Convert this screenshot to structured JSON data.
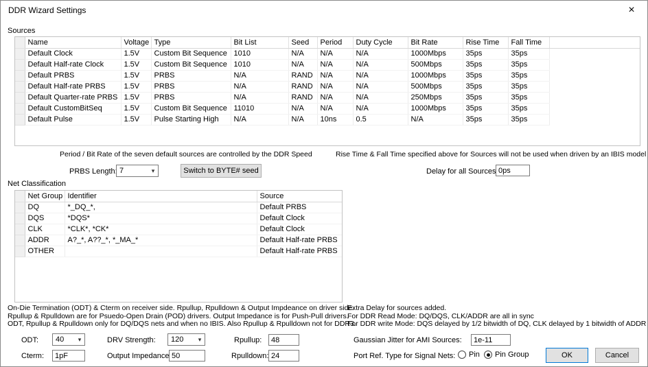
{
  "window": {
    "title": "DDR Wizard Settings",
    "close_glyph": "×"
  },
  "sources": {
    "section_label": "Sources",
    "table": {
      "columns": [
        "Name",
        "Voltage",
        "Type",
        "Bit List",
        "Seed",
        "Period",
        "Duty Cycle",
        "Bit Rate",
        "Rise Time",
        "Fall Time"
      ],
      "rows": [
        [
          "Default Clock",
          "1.5V",
          "Custom Bit Sequence",
          "1010",
          "N/A",
          "N/A",
          "N/A",
          "1000Mbps",
          "35ps",
          "35ps"
        ],
        [
          "Default Half-rate Clock",
          "1.5V",
          "Custom Bit Sequence",
          "1010",
          "N/A",
          "N/A",
          "N/A",
          "500Mbps",
          "35ps",
          "35ps"
        ],
        [
          "Default PRBS",
          "1.5V",
          "PRBS",
          "N/A",
          "RAND",
          "N/A",
          "N/A",
          "1000Mbps",
          "35ps",
          "35ps"
        ],
        [
          "Default Half-rate PRBS",
          "1.5V",
          "PRBS",
          "N/A",
          "RAND",
          "N/A",
          "N/A",
          "500Mbps",
          "35ps",
          "35ps"
        ],
        [
          "Default Quarter-rate PRBS",
          "1.5V",
          "PRBS",
          "N/A",
          "RAND",
          "N/A",
          "N/A",
          "250Mbps",
          "35ps",
          "35ps"
        ],
        [
          "Default CustomBitSeq",
          "1.5V",
          "Custom Bit Sequence",
          "11010",
          "N/A",
          "N/A",
          "N/A",
          "1000Mbps",
          "35ps",
          "35ps"
        ],
        [
          "Default Pulse",
          "1.5V",
          "Pulse Starting High",
          "N/A",
          "N/A",
          "10ns",
          "0.5",
          "N/A",
          "35ps",
          "35ps"
        ]
      ]
    },
    "note_left": "Period / Bit Rate of the seven default sources are controlled by the DDR Speed",
    "note_right": "Rise Time & Fall Time specified above for Sources will not be used when driven by an IBIS model",
    "prbs_length": {
      "label": "PRBS Length:",
      "value": "7"
    },
    "switch_seed_button_label": "Switch to BYTE# seed",
    "delay": {
      "label": "Delay for all Sources:",
      "value": "0ps"
    }
  },
  "net_classification": {
    "section_label": "Net Classification",
    "table": {
      "columns": [
        "Net Group",
        "Identifier",
        "Source"
      ],
      "rows": [
        [
          "DQ",
          "*_DQ_*,",
          "Default PRBS"
        ],
        [
          "DQS",
          "*DQS*",
          "Default Clock"
        ],
        [
          "CLK",
          "*CLK*, *CK*",
          "Default Clock"
        ],
        [
          "ADDR",
          "A?_*, A??_*, *_MA_*",
          "Default Half-rate PRBS"
        ],
        [
          "OTHER",
          "",
          "Default Half-rate PRBS"
        ]
      ]
    }
  },
  "notes": {
    "left": [
      "On-Die Termination (ODT) & Cterm on receiver side.  Rpullup, Rpulldown & Output Impdeance on driver side.",
      "Rpullup & Rpulldown are for Psuedo-Open Drain (POD) drivers.  Output Impedance is for Push-Pull drivers.",
      "ODT, Rpullup & Rpulldown only for DQ/DQS nets and when no IBIS.  Also Rpullup & Rpulldown not for DDR3."
    ],
    "right": [
      "Extra Delay for sources added.",
      "For DDR Read Mode: DQ/DQS, CLK/ADDR are all in sync",
      "For DDR write Mode: DQS delayed by 1/2 bitwidth of DQ, CLK delayed by 1 bitwidth of ADDR"
    ]
  },
  "termination": {
    "odt": {
      "label": "ODT:",
      "value": "40"
    },
    "cterm": {
      "label": "Cterm:",
      "value": "1pF"
    },
    "drv_strength": {
      "label": "DRV Strength:",
      "value": "120"
    },
    "output_impedance": {
      "label": "Output Impedance:",
      "value": "50"
    },
    "rpullup": {
      "label": "Rpullup:",
      "value": "48"
    },
    "rpulldown": {
      "label": "Rpulldown:",
      "value": "24"
    }
  },
  "ami": {
    "jitter": {
      "label": "Gaussian Jitter for AMI Sources:",
      "value": "1e-11"
    },
    "port_ref": {
      "label": "Port Ref. Type for Signal Nets:",
      "options": [
        "Pin",
        "Pin Group"
      ],
      "selected": "Pin Group"
    }
  },
  "actions": {
    "ok_label": "OK",
    "cancel_label": "Cancel"
  }
}
